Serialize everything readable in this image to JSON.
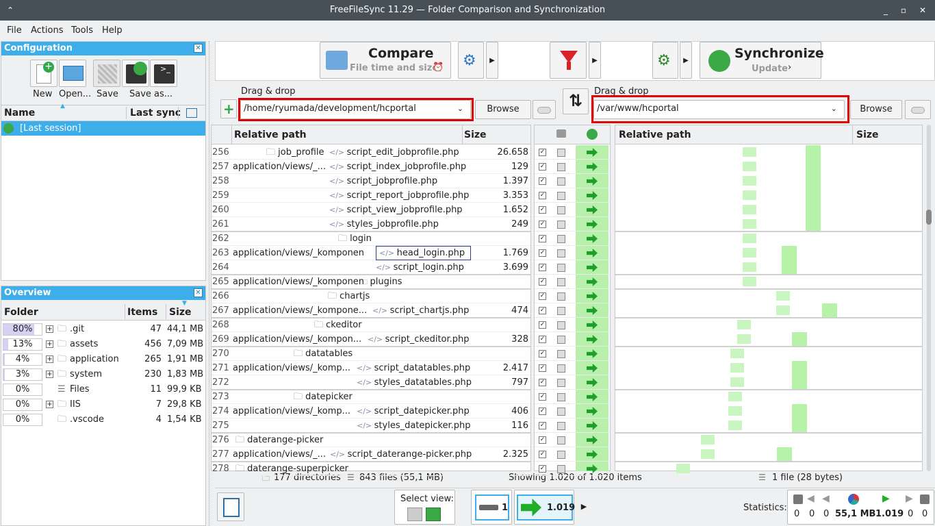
{
  "window": {
    "title": "FreeFileSync 11.29 — Folder Comparison and Synchronization"
  },
  "menu": [
    "File",
    "Actions",
    "Tools",
    "Help"
  ],
  "config": {
    "title": "Configuration",
    "buttons": [
      "New",
      "Open...",
      "Save",
      "Save as..."
    ],
    "col_name": "Name",
    "col_last_sync": "Last sync",
    "session": "[Last session]"
  },
  "overview": {
    "title": "Overview",
    "col_folder": "Folder",
    "col_items": "Items",
    "col_size": "Size",
    "rows": [
      {
        "pct": "80%",
        "fill": 0.8,
        "name": ".git",
        "items": "47",
        "size": "44,1 MB"
      },
      {
        "pct": "13%",
        "fill": 0.13,
        "name": "assets",
        "items": "456",
        "size": "7,09 MB"
      },
      {
        "pct": "4%",
        "fill": 0.04,
        "name": "application",
        "items": "265",
        "size": "1,91 MB"
      },
      {
        "pct": "3%",
        "fill": 0.03,
        "name": "system",
        "items": "230",
        "size": "1,83 MB"
      },
      {
        "pct": "0%",
        "fill": 0,
        "name": "Files",
        "items": "11",
        "size": "99,9 KB"
      },
      {
        "pct": "0%",
        "fill": 0,
        "name": "IIS",
        "items": "7",
        "size": "29,8 KB"
      },
      {
        "pct": "0%",
        "fill": 0,
        "name": ".vscode",
        "items": "4",
        "size": "1,54 KB"
      }
    ]
  },
  "toolbar": {
    "compare_label": "Compare",
    "compare_sub": "File time and size",
    "sync_label": "Synchronize",
    "sync_sub": "Update"
  },
  "left_folder": {
    "drag": "Drag & drop",
    "path": "/home/ryumada/development/hcportal",
    "browse": "Browse"
  },
  "right_folder": {
    "drag": "Drag & drop",
    "path": "/var/www/hcportal",
    "browse": "Browse"
  },
  "grid": {
    "col_path": "Relative path",
    "col_size": "Size",
    "rows": [
      {
        "n": "256",
        "folder": "job_profile",
        "file": "script_edit_jobprofile.php",
        "size": "26.658"
      },
      {
        "n": "257",
        "folder": "application/views/_...",
        "file": "script_index_jobprofile.php",
        "size": "129"
      },
      {
        "n": "258",
        "folder": "",
        "file": "script_jobprofile.php",
        "size": "1.397"
      },
      {
        "n": "259",
        "folder": "",
        "file": "script_report_jobprofile.php",
        "size": "3.353"
      },
      {
        "n": "260",
        "folder": "",
        "file": "script_view_jobprofile.php",
        "size": "1.652"
      },
      {
        "n": "261",
        "folder": "",
        "file": "styles_jobprofile.php",
        "size": "249"
      },
      {
        "n": "262",
        "folder": "login",
        "file": "",
        "size": ""
      },
      {
        "n": "263",
        "folder": "application/views/_komponen",
        "file": "head_login.php",
        "size": "1.769"
      },
      {
        "n": "264",
        "folder": "",
        "file": "script_login.php",
        "size": "3.699"
      },
      {
        "n": "265",
        "folder": "application/views/_komponen",
        "file": "plugins",
        "size": ""
      },
      {
        "n": "266",
        "folder": "chartjs",
        "file": "",
        "size": ""
      },
      {
        "n": "267",
        "folder": "application/views/_kompone...",
        "file": "script_chartjs.php",
        "size": "474"
      },
      {
        "n": "268",
        "folder": "ckeditor",
        "file": "",
        "size": ""
      },
      {
        "n": "269",
        "folder": "application/views/_kompon...",
        "file": "script_ckeditor.php",
        "size": "328"
      },
      {
        "n": "270",
        "folder": "datatables",
        "file": "",
        "size": ""
      },
      {
        "n": "271",
        "folder": "application/views/_komp...",
        "file": "script_datatables.php",
        "size": "2.417"
      },
      {
        "n": "272",
        "folder": "",
        "file": "styles_datatables.php",
        "size": "797"
      },
      {
        "n": "273",
        "folder": "datepicker",
        "file": "",
        "size": ""
      },
      {
        "n": "274",
        "folder": "application/views/_komp...",
        "file": "script_datepicker.php",
        "size": "406"
      },
      {
        "n": "275",
        "folder": "",
        "file": "styles_datepicker.php",
        "size": "116"
      },
      {
        "n": "276",
        "folder": "daterange-picker",
        "file": "",
        "size": ""
      },
      {
        "n": "277",
        "folder": "application/views/_...",
        "file": "script_daterange-picker.php",
        "size": "2.325"
      },
      {
        "n": "278",
        "folder": "daterange-superpicker",
        "file": "",
        "size": ""
      }
    ]
  },
  "status": {
    "dirs": "177 directories",
    "files": "843 files (55,1 MB)",
    "showing": "Showing 1.020 of 1.020 items",
    "right_files": "1 file (28 bytes)"
  },
  "bottom": {
    "select_view": "Select view:",
    "equal_count": "1",
    "create_count": "1.019",
    "statistics": "Statistics:",
    "stats": [
      "0",
      "0",
      "0",
      "55,1 MB",
      "1.019",
      "0",
      "0"
    ]
  }
}
